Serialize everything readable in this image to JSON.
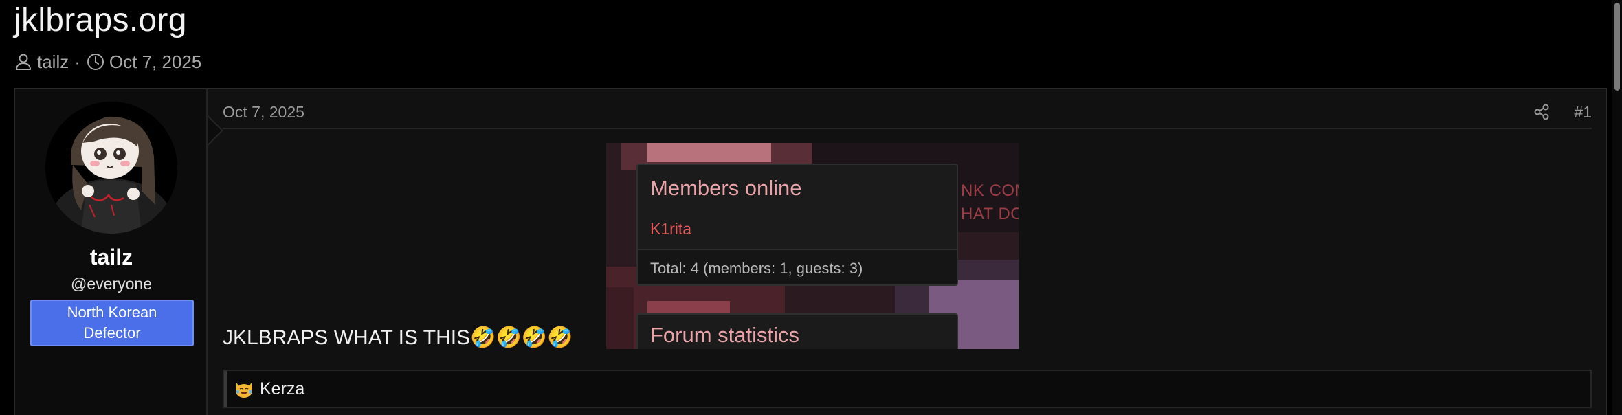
{
  "thread": {
    "title": "jklbraps.org",
    "author": "tailz",
    "separator": "·",
    "date": "Oct 7, 2025"
  },
  "post": {
    "user": {
      "name": "tailz",
      "title": "@everyone",
      "banner": "North Korean Defector"
    },
    "date": "Oct 7, 2025",
    "number": "#1",
    "body_text": "JKLBRAPS WHAT IS THIS🤣🤣🤣🤣",
    "embed": {
      "members_title": "Members online",
      "member": "K1rita",
      "total": "Total: 4 (members: 1, guests: 3)",
      "stats_title": "Forum statistics",
      "side_line1": "NK COM",
      "side_line2": "HAT DO"
    },
    "reaction": {
      "icon": "laughing-cat-icon",
      "user": "Kerza"
    }
  },
  "colors": {
    "background": "#000000",
    "post_bg": "#111111",
    "banner": "#4a6fe8",
    "embed_accent": "#e9a3a9",
    "member_name": "#e05a5a"
  }
}
